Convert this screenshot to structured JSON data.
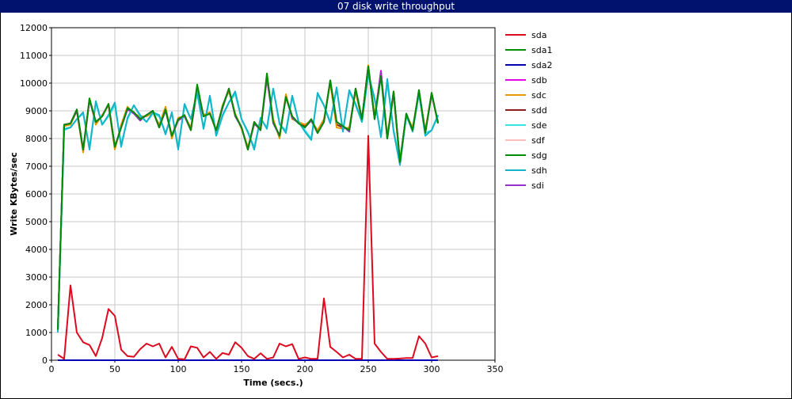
{
  "chart_data": {
    "type": "line",
    "title": "07 disk write throughput",
    "xlabel": "Time (secs.)",
    "ylabel": "Write KBytes/sec",
    "xlim": [
      0,
      350
    ],
    "ylim": [
      0,
      12000
    ],
    "xticks": [
      0,
      50,
      100,
      150,
      200,
      250,
      300,
      350
    ],
    "yticks": [
      0,
      1000,
      2000,
      3000,
      4000,
      5000,
      6000,
      7000,
      8000,
      9000,
      10000,
      11000,
      12000
    ],
    "grid": true,
    "legend_position": "right",
    "x": [
      5,
      10,
      15,
      20,
      25,
      30,
      35,
      40,
      45,
      50,
      55,
      60,
      65,
      70,
      75,
      80,
      85,
      90,
      95,
      100,
      105,
      110,
      115,
      120,
      125,
      130,
      135,
      140,
      145,
      150,
      155,
      160,
      165,
      170,
      175,
      180,
      185,
      190,
      195,
      200,
      205,
      210,
      215,
      220,
      225,
      230,
      235,
      240,
      245,
      250,
      255,
      260,
      265,
      270,
      275,
      280,
      285,
      290,
      295,
      300,
      305
    ],
    "series": [
      {
        "name": "sda",
        "color": "#dc0a1e",
        "values": [
          200,
          50,
          2700,
          1000,
          650,
          550,
          150,
          800,
          1850,
          1600,
          380,
          150,
          120,
          400,
          600,
          500,
          600,
          100,
          480,
          50,
          30,
          500,
          450,
          100,
          300,
          50,
          260,
          200,
          650,
          450,
          150,
          50,
          250,
          50,
          100,
          600,
          500,
          580,
          50,
          100,
          50,
          50,
          2230,
          480,
          300,
          100,
          200,
          50,
          50,
          8100,
          600,
          300,
          50,
          50,
          60,
          80,
          80,
          870,
          600,
          100,
          150
        ]
      },
      {
        "name": "sda1",
        "color": "#008c00",
        "values": [
          0,
          0,
          0,
          0,
          0,
          0,
          0,
          0,
          0,
          0,
          0,
          0,
          0,
          0,
          0,
          0,
          0,
          0,
          0,
          0,
          0,
          0,
          0,
          0,
          0,
          0,
          0,
          0,
          0,
          0,
          0,
          0,
          0,
          0,
          0,
          0,
          0,
          0,
          0,
          0,
          0,
          0,
          0,
          0,
          0,
          0,
          0,
          0,
          0,
          0,
          0,
          0,
          0,
          0,
          0,
          0,
          0,
          0,
          0,
          0,
          0
        ]
      },
      {
        "name": "sda2",
        "color": "#0000b4",
        "values": [
          0,
          0,
          0,
          0,
          0,
          0,
          0,
          0,
          0,
          0,
          0,
          0,
          0,
          0,
          0,
          0,
          0,
          0,
          0,
          0,
          0,
          0,
          0,
          0,
          0,
          0,
          0,
          0,
          0,
          0,
          0,
          0,
          0,
          0,
          0,
          0,
          0,
          0,
          0,
          0,
          0,
          0,
          0,
          0,
          0,
          0,
          0,
          0,
          0,
          0,
          0,
          0,
          0,
          0,
          0,
          0,
          0,
          0,
          0,
          0,
          0
        ]
      },
      {
        "name": "sdb",
        "color": "#e600e6",
        "values": [
          1100,
          8500,
          8550,
          9050,
          7600,
          9400,
          8600,
          8800,
          9250,
          7700,
          8400,
          9100,
          8950,
          8700,
          8850,
          9000,
          8400,
          9050,
          8100,
          8700,
          8850,
          8300,
          9800,
          8800,
          8900,
          8300,
          9150,
          9800,
          8850,
          8400,
          7600,
          8600,
          8300,
          10250,
          8600,
          8100,
          9500,
          8800,
          8550,
          8400,
          8700,
          8200,
          8600,
          10100,
          8600,
          8450,
          8300,
          9800,
          8700,
          10600,
          8700,
          10450,
          8000,
          9700,
          7150,
          8900,
          8300,
          9750,
          8200,
          9650,
          8550
        ]
      },
      {
        "name": "sdc",
        "color": "#e69600",
        "values": [
          1100,
          8450,
          8500,
          9000,
          7500,
          9450,
          8500,
          8850,
          9200,
          7600,
          8500,
          9150,
          8900,
          8800,
          8800,
          8950,
          8500,
          9150,
          8000,
          8750,
          8800,
          8400,
          9700,
          8850,
          8950,
          8250,
          9200,
          9700,
          8900,
          8350,
          7700,
          8500,
          8400,
          10150,
          8700,
          8000,
          9600,
          8700,
          8600,
          8500,
          8650,
          8300,
          8700,
          10000,
          8400,
          8350,
          8400,
          9700,
          8650,
          10650,
          8800,
          10350,
          8100,
          9600,
          7050,
          8850,
          8400,
          9650,
          8300,
          9600,
          8600
        ]
      },
      {
        "name": "sdd",
        "color": "#8c1e1e",
        "values": [
          1100,
          8480,
          8520,
          9020,
          7550,
          9420,
          8550,
          8820,
          9220,
          7650,
          8450,
          9120,
          8920,
          8750,
          8820,
          8980,
          8450,
          9100,
          8050,
          8720,
          8820,
          8350,
          9750,
          8820,
          8920,
          8280,
          9170,
          9750,
          8870,
          8380,
          7650,
          8550,
          8350,
          10200,
          8650,
          8050,
          9550,
          8750,
          8570,
          8450,
          8680,
          8250,
          8650,
          10050,
          8500,
          8400,
          8350,
          9750,
          8680,
          10620,
          8750,
          10400,
          8050,
          9650,
          7100,
          8870,
          8350,
          9700,
          8250,
          9620,
          8570
        ]
      },
      {
        "name": "sde",
        "color": "#33e6e6",
        "values": [
          1050,
          8300,
          8400,
          8700,
          8900,
          7700,
          9300,
          8500,
          8800,
          9200,
          7800,
          8700,
          9200,
          8800,
          8600,
          8900,
          8800,
          8200,
          8900,
          7700,
          9200,
          8700,
          9600,
          8400,
          9500,
          8100,
          8800,
          9300,
          9600,
          8700,
          8200,
          7700,
          8700,
          8400,
          9800,
          8500,
          8300,
          9500,
          8600,
          8300,
          8000,
          9600,
          9200,
          8600,
          9800,
          8300,
          9700,
          9200,
          8600,
          10300,
          9400,
          8100,
          10000,
          8300,
          7150,
          8800,
          8300,
          9600,
          8200,
          8300,
          8800
        ]
      },
      {
        "name": "sdf",
        "color": "#ffbebe",
        "values": [
          1100,
          8480,
          8520,
          9020,
          7550,
          9420,
          8550,
          8820,
          9220,
          7650,
          8450,
          9120,
          8920,
          8750,
          8820,
          8980,
          8450,
          9100,
          8050,
          8720,
          8820,
          8350,
          9750,
          8820,
          8920,
          8280,
          9170,
          9750,
          8870,
          8380,
          7650,
          8550,
          8350,
          10200,
          8650,
          8050,
          9550,
          8750,
          8570,
          8450,
          8680,
          8250,
          8650,
          10050,
          8500,
          8400,
          8350,
          9750,
          8680,
          10620,
          8750,
          10400,
          8050,
          9650,
          7100,
          8870,
          8350,
          9700,
          8250,
          9620,
          8570
        ]
      },
      {
        "name": "sdg",
        "color": "#008c00",
        "values": [
          1100,
          8500,
          8550,
          9050,
          7600,
          9450,
          8600,
          8800,
          9250,
          7700,
          8400,
          9100,
          8950,
          8700,
          8850,
          9000,
          8400,
          9050,
          8100,
          8700,
          8850,
          8300,
          9950,
          8800,
          8900,
          8300,
          9150,
          9800,
          8850,
          8400,
          7600,
          8600,
          8300,
          10350,
          8600,
          8100,
          9500,
          8800,
          8550,
          8400,
          8700,
          8200,
          8600,
          10100,
          8600,
          8450,
          8300,
          9800,
          8700,
          10600,
          8700,
          10250,
          8000,
          9700,
          7150,
          8900,
          8300,
          9750,
          8200,
          9650,
          8550
        ]
      },
      {
        "name": "sdh",
        "color": "#14b4c8",
        "values": [
          1000,
          8350,
          8400,
          8700,
          8950,
          7600,
          9350,
          8500,
          8850,
          9300,
          7700,
          8750,
          9200,
          8850,
          8600,
          8950,
          8850,
          8150,
          8950,
          7600,
          9250,
          8700,
          9700,
          8350,
          9550,
          8100,
          8850,
          9300,
          9700,
          8700,
          8250,
          7600,
          8750,
          8350,
          9800,
          8550,
          8200,
          9550,
          8600,
          8250,
          7950,
          9650,
          9200,
          8550,
          9850,
          8250,
          9750,
          9250,
          8600,
          10350,
          9450,
          8050,
          10150,
          8250,
          7050,
          8850,
          8250,
          9650,
          8100,
          8300,
          8850
        ]
      },
      {
        "name": "sdi",
        "color": "#9632c8",
        "values": [
          1100,
          8500,
          8550,
          9000,
          7600,
          9400,
          8600,
          8800,
          9250,
          7700,
          8400,
          9050,
          8900,
          8650,
          8850,
          9000,
          8400,
          9000,
          8100,
          8650,
          8800,
          8300,
          9800,
          8800,
          8900,
          8300,
          9100,
          9800,
          8800,
          8400,
          7600,
          8550,
          8300,
          10200,
          8550,
          8100,
          9500,
          8750,
          8550,
          8400,
          8650,
          8200,
          8600,
          10100,
          8600,
          8450,
          8250,
          9800,
          8700,
          10600,
          8700,
          10400,
          8000,
          9650,
          7200,
          8850,
          8300,
          9700,
          8200,
          9600,
          8600
        ]
      }
    ]
  }
}
